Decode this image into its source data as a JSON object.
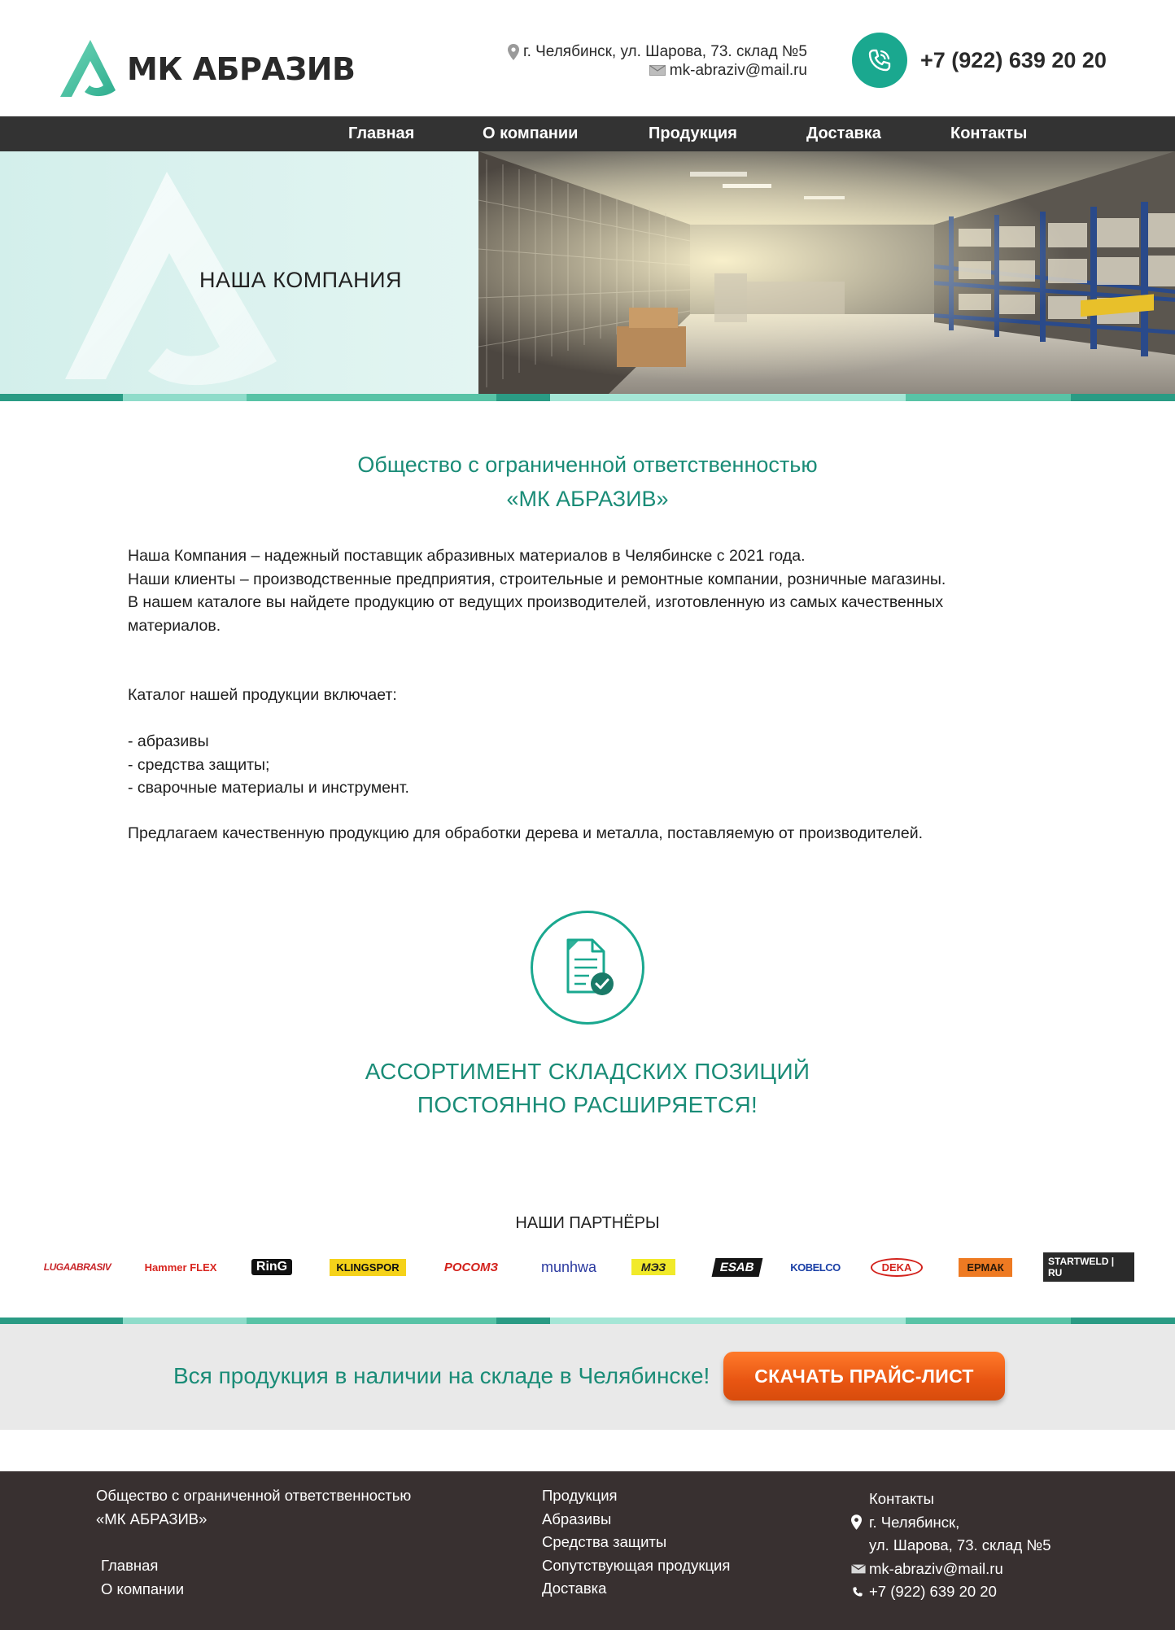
{
  "header": {
    "logo_text": "МК АБРАЗИВ",
    "address": "г. Челябинск, ул. Шарова, 73. склад №5",
    "email": "mk-abraziv@mail.ru",
    "phone": "+7 (922) 639 20 20"
  },
  "nav": {
    "items": [
      "Главная",
      "О компании",
      "Продукция",
      "Доставка",
      "Контакты"
    ]
  },
  "hero": {
    "title": "НАША КОМПАНИЯ"
  },
  "main": {
    "org_line1": "Общество с ограниченной ответственностью",
    "org_line2": "«МК АБРАЗИВ»",
    "intro_lines": [
      "Наша Компания – надежный поставщик абразивных материалов в Челябинске с 2021 года.",
      "Наши клиенты – производственные предприятия, строительные и ремонтные компании, розничные магазины.",
      "В нашем каталоге вы найдете продукцию от ведущих производителей, изготовленную из самых качественных",
      "материалов."
    ],
    "catalog_heading": "Каталог нашей продукции включает:",
    "catalog_items": [
      "- абразивы",
      "- средства защиты;",
      "- сварочные материалы и инструмент."
    ],
    "closing": "Предлагаем качественную продукцию для обработки дерева и металла, поставляемую от производителей.",
    "assortment_line1": "АССОРТИМЕНТ СКЛАДСКИХ ПОЗИЦИЙ",
    "assortment_line2": "ПОСТОЯННО РАСШИРЯЕТСЯ!"
  },
  "partners": {
    "title": "НАШИ ПАРТНЁРЫ",
    "logos": [
      "LUGAABRASIV",
      "Hammer FLEX",
      "RinG",
      "KLINGSPOR",
      "РОСОМЗ",
      "munhwa",
      "МЭЗ",
      "ESAB",
      "KOBELCO",
      "DEKA",
      "ЕРМАК",
      "STARTWELD | RU"
    ]
  },
  "cta": {
    "text": "Вся продукция в наличии на складе в Челябинске!",
    "button": "СКАЧАТЬ ПРАЙС-ЛИСТ"
  },
  "footer": {
    "org_line1": "Общество с ограниченной ответственностью",
    "org_line2": "«МК АБРАЗИВ»",
    "links_left": [
      "Главная",
      "О компании"
    ],
    "links_middle": [
      "Продукция",
      "Абразивы",
      "Средства защиты",
      "Сопутствующая продукция",
      "Доставка"
    ],
    "contacts_title": "Контакты",
    "city": "г. Челябинск,",
    "street": "ул. Шарова, 73. склад №5",
    "email": "mk-abraziv@mail.ru",
    "phone": "+7 (922) 639 20 20"
  },
  "colors": {
    "accent": "#1a8c77",
    "teal_icon": "#1aa88f",
    "nav_bg": "#333333",
    "footer_bg": "#383030",
    "cta_bg": "#e9e9e9",
    "button_orange": "#e85512"
  }
}
